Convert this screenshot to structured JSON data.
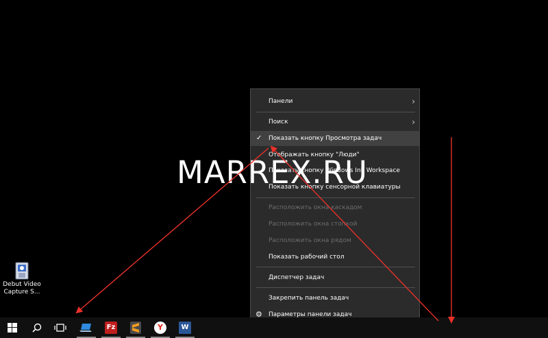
{
  "desktop": {
    "icon_label_line1": "Debut Video",
    "icon_label_line2": "Capture S...",
    "icon_name": "debut-video-capture-icon"
  },
  "watermark": "MARREX.RU",
  "menu": {
    "items": [
      {
        "label": "Панели",
        "submenu": true
      },
      {
        "label": "Поиск",
        "submenu": true
      },
      {
        "label": "Показать кнопку Просмотра задач",
        "checked": true
      },
      {
        "label": "Отображать кнопку \"Люди\""
      },
      {
        "label": "Показать кнопку Windows Ink Workspace"
      },
      {
        "label": "Показать кнопку сенсорной клавиатуры"
      },
      {
        "label": "Расположить окна каскадом",
        "disabled": true
      },
      {
        "label": "Расположить окна стопкой",
        "disabled": true
      },
      {
        "label": "Расположить окна рядом",
        "disabled": true
      },
      {
        "label": "Показать рабочий стол"
      },
      {
        "label": "Диспетчер задач"
      },
      {
        "label": "Закрепить панель задач"
      },
      {
        "label": "Параметры панели задач"
      }
    ],
    "chevron": "›",
    "checkmark": "✓",
    "settings_icon": "⚙"
  },
  "taskbar": {
    "items": [
      "start",
      "search",
      "task-view",
      "laptop-app",
      "filezilla",
      "sublime-text",
      "yandex-browser",
      "word"
    ],
    "filezilla_glyph": "Fz",
    "word_glyph": "W",
    "yandex_glyph": "Y"
  },
  "colors": {
    "arrow": "#e8312a",
    "menu_bg": "#2b2b2b",
    "taskbar_bg": "#101010"
  }
}
